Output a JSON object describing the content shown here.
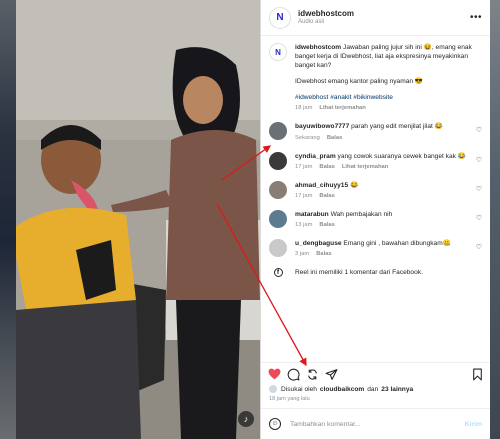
{
  "post": {
    "username": "idwebhostcom",
    "subtitle": "Audio asli",
    "more_label": "•••"
  },
  "caption": {
    "username": "idwebhostcom",
    "text": "Jawaban paling jujur sih ini 😆, emang enak banget kerja di IDwebhost, liat aja ekspresinya meyakinkan banget kan?",
    "line2": "IDwebhost emang kantor paling nyaman 😎",
    "tags": "#idwebhost #anakit #bikinwebsite",
    "time": "18 jam",
    "translate": "Lihat terjemahan"
  },
  "comments": [
    {
      "username": "bayuwibowo7777",
      "text": "parah yang edit menjilat jilat 😂",
      "time": "Sekarang",
      "reply": "Balas",
      "translate": "",
      "avatar_color": "#6b6f76"
    },
    {
      "username": "cyndia_pram",
      "text": "yang cowok suaranya cewek banget kak 😂",
      "time": "17 jam",
      "reply": "Balas",
      "translate": "Lihat terjemahan",
      "avatar_color": "#3a3a3a"
    },
    {
      "username": "ahmad_cihuyy15",
      "text": "😂",
      "time": "17 jam",
      "reply": "Balas",
      "translate": "",
      "avatar_color": "#8a7e74"
    },
    {
      "username": "matarabun",
      "text": "Wah pembajakan nih",
      "time": "13 jam",
      "reply": "Balas",
      "translate": "",
      "avatar_color": "#5d7b8e"
    },
    {
      "username": "u_dengbaguse",
      "text": "Emang gini , bawahan dibungkam🤐",
      "time": "3 jam",
      "reply": "Balas",
      "translate": "",
      "avatar_color": "#c9c9c9"
    }
  ],
  "facebook_note": "Reel ini memiliki 1 komentar dari Facebook.",
  "likes": {
    "prefix": "Disukai oleh",
    "user": "cloudbaikcom",
    "joiner": "dan",
    "others": "23 lainnya"
  },
  "time_ago": "18 jam yang lalu",
  "add_comment": {
    "placeholder": "Tambahkan komentar...",
    "post_label": "Kirim"
  },
  "colors": {
    "like_red": "#ed4956",
    "annotation_red": "#e0161b",
    "link_blue": "#00376b"
  },
  "icons": {
    "like": "heart-icon",
    "comment": "comment-icon",
    "repost": "repost-icon",
    "share": "share-icon",
    "save": "bookmark-icon"
  }
}
